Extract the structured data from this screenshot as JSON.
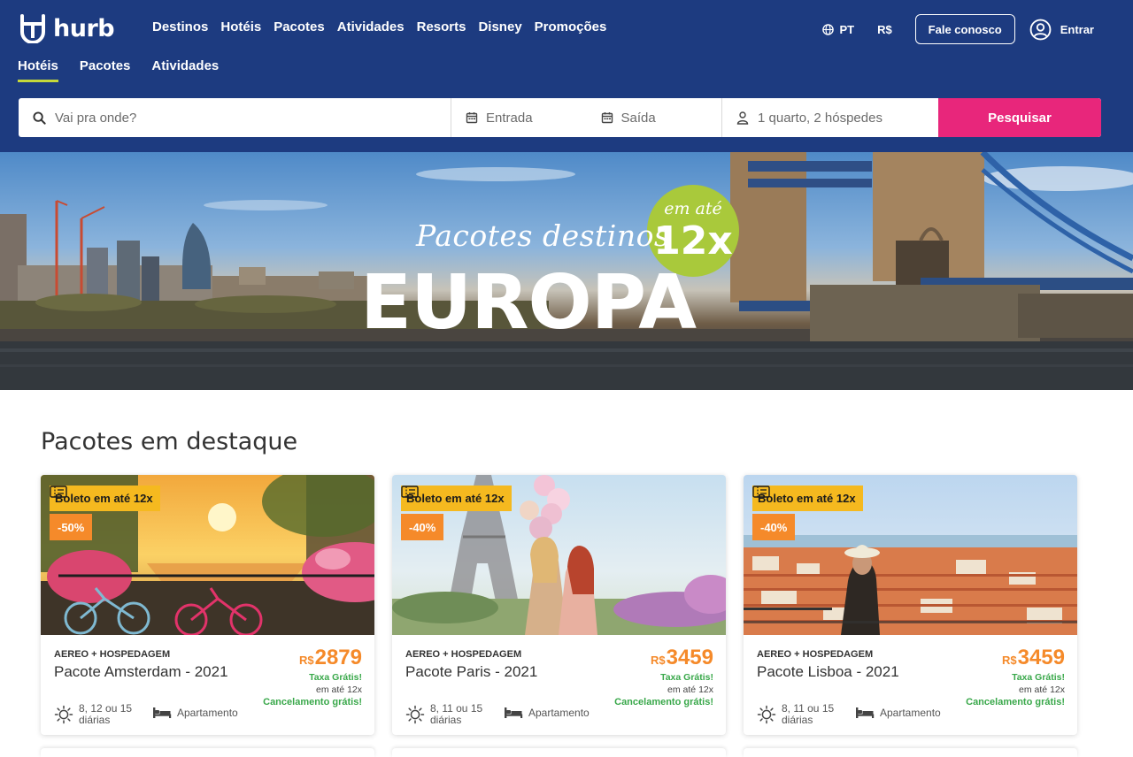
{
  "brand": {
    "name": "hurb"
  },
  "nav": {
    "items": [
      "Destinos",
      "Hotéis",
      "Pacotes",
      "Atividades",
      "Resorts",
      "Disney",
      "Promoções"
    ]
  },
  "tools": {
    "language": "PT",
    "currency": "R$",
    "contact_label": "Fale conosco",
    "login_label": "Entrar"
  },
  "subnav": {
    "items": [
      "Hotéis",
      "Pacotes",
      "Atividades"
    ],
    "active": "Hotéis"
  },
  "search": {
    "destination_placeholder": "Vai pra onde?",
    "checkin_placeholder": "Entrada",
    "checkout_placeholder": "Saída",
    "guests_value": "1 quarto, 2 hóspedes",
    "submit_label": "Pesquisar"
  },
  "banner": {
    "subtitle": "Pacotes destinos",
    "title": "EUROPA",
    "badge_small": "em até",
    "badge_big": "12x"
  },
  "section": {
    "title": "Pacotes em destaque"
  },
  "cards": [
    {
      "boleto": "Boleto em até 12x",
      "discount": "-50%",
      "type": "AEREO + HOSPEDAGEM",
      "name": "Pacote Amsterdam - 2021",
      "currency": "R$",
      "price": "2879",
      "tax": "Taxa Grátis!",
      "installments": "em até 12x",
      "cancel": "Cancelamento grátis!",
      "days": "8, 12 ou 15 diárias",
      "room": "Apartamento"
    },
    {
      "boleto": "Boleto em até 12x",
      "discount": "-40%",
      "type": "AEREO + HOSPEDAGEM",
      "name": "Pacote Paris - 2021",
      "currency": "R$",
      "price": "3459",
      "tax": "Taxa Grátis!",
      "installments": "em até 12x",
      "cancel": "Cancelamento grátis!",
      "days": "8, 11 ou 15 diárias",
      "room": "Apartamento"
    },
    {
      "boleto": "Boleto em até 12x",
      "discount": "-40%",
      "type": "AEREO + HOSPEDAGEM",
      "name": "Pacote Lisboa - 2021",
      "currency": "R$",
      "price": "3459",
      "tax": "Taxa Grátis!",
      "installments": "em até 12x",
      "cancel": "Cancelamento grátis!",
      "days": "8, 11 ou 15 diárias",
      "room": "Apartamento"
    }
  ],
  "colors": {
    "header": "#1d3b80",
    "accent_pink": "#e8267b",
    "active_underline": "#c5d83a",
    "badge_green": "#a9c93b",
    "boleto_yellow": "#f5b91f",
    "price_orange": "#f58a2a",
    "positive_green": "#39a84a"
  },
  "icons": {
    "globe": "globe-icon",
    "user": "user-circle-icon",
    "search": "search-icon",
    "calendar": "calendar-icon",
    "guest": "person-icon",
    "ticket": "ticket-icon",
    "sun": "sun-icon",
    "bed": "bed-icon"
  }
}
